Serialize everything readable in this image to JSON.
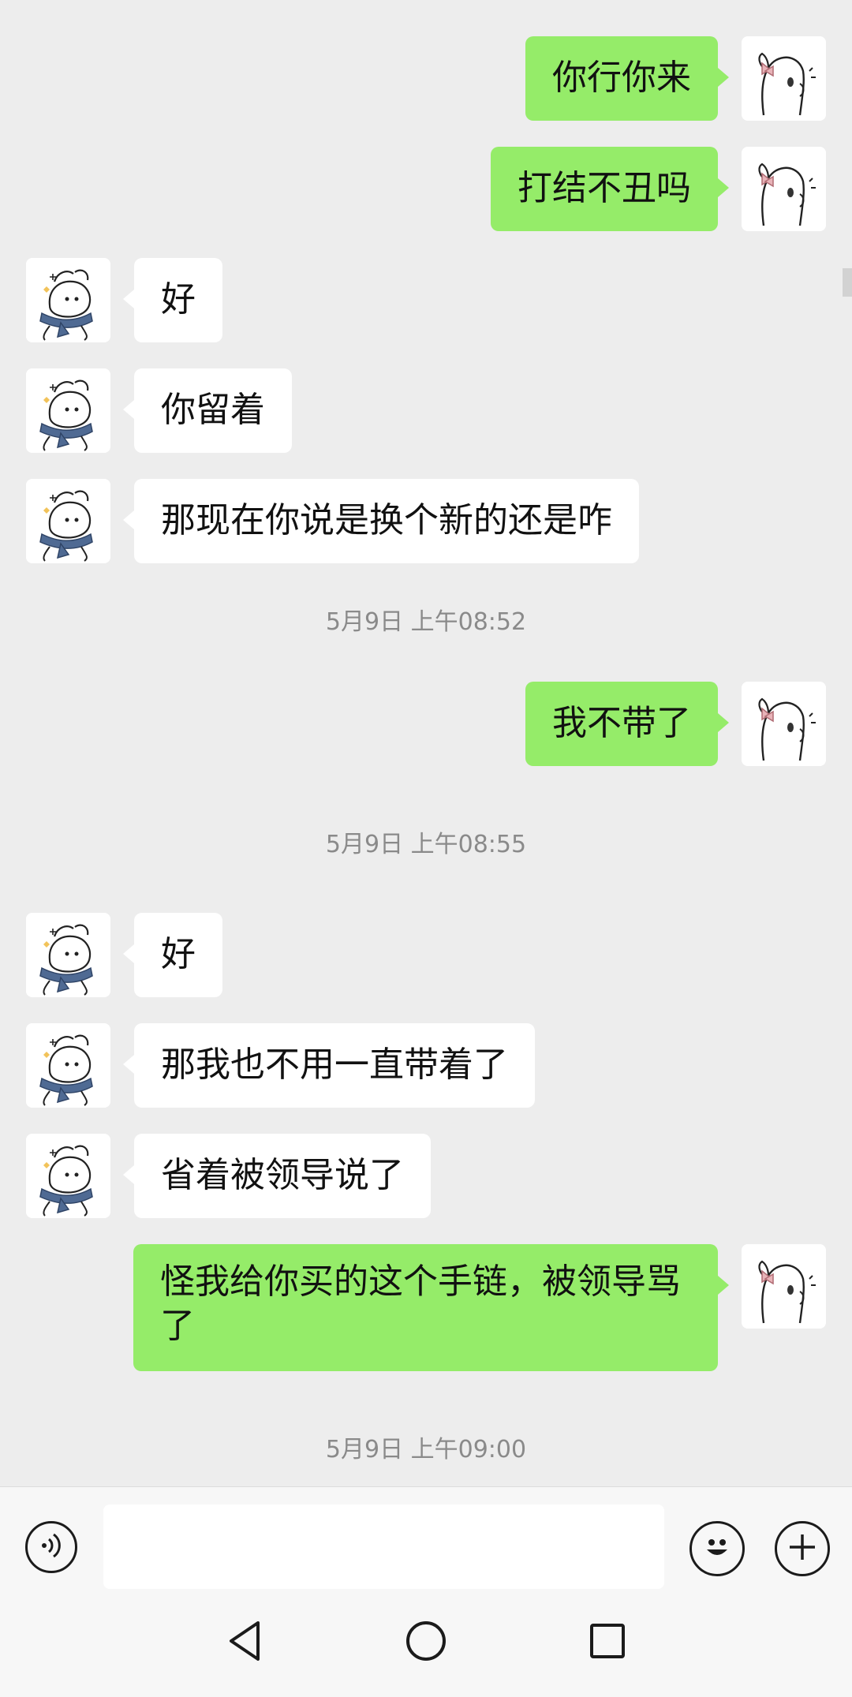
{
  "messages": [
    {
      "side": "mine",
      "text": "你行你来"
    },
    {
      "side": "mine",
      "text": "打结不丑吗"
    },
    {
      "side": "theirs",
      "text": "好"
    },
    {
      "side": "theirs",
      "text": "你留着"
    },
    {
      "side": "theirs",
      "text": "那现在你说是换个新的还是咋"
    },
    {
      "side": "mine",
      "text": "我不带了"
    },
    {
      "side": "theirs",
      "text": "好"
    },
    {
      "side": "theirs",
      "text": "那我也不用一直带着了"
    },
    {
      "side": "theirs",
      "text": "省着被领导说了"
    },
    {
      "side": "mine",
      "text": "怪我给你买的这个手链，被领导骂了"
    }
  ],
  "timestamps": [
    "5月9日 上午08:52",
    "5月9日 上午08:55",
    "5月9日 上午09:00"
  ],
  "input": {
    "value": "",
    "placeholder": ""
  },
  "icons": {
    "voice": "voice-icon",
    "emoji": "emoji-icon",
    "plus": "plus-icon",
    "back": "back-triangle-icon",
    "home": "home-circle-icon",
    "recent": "recent-square-icon"
  },
  "colors": {
    "my_bubble": "#95ec69",
    "their_bubble": "#ffffff",
    "chat_bg": "#ededed"
  }
}
